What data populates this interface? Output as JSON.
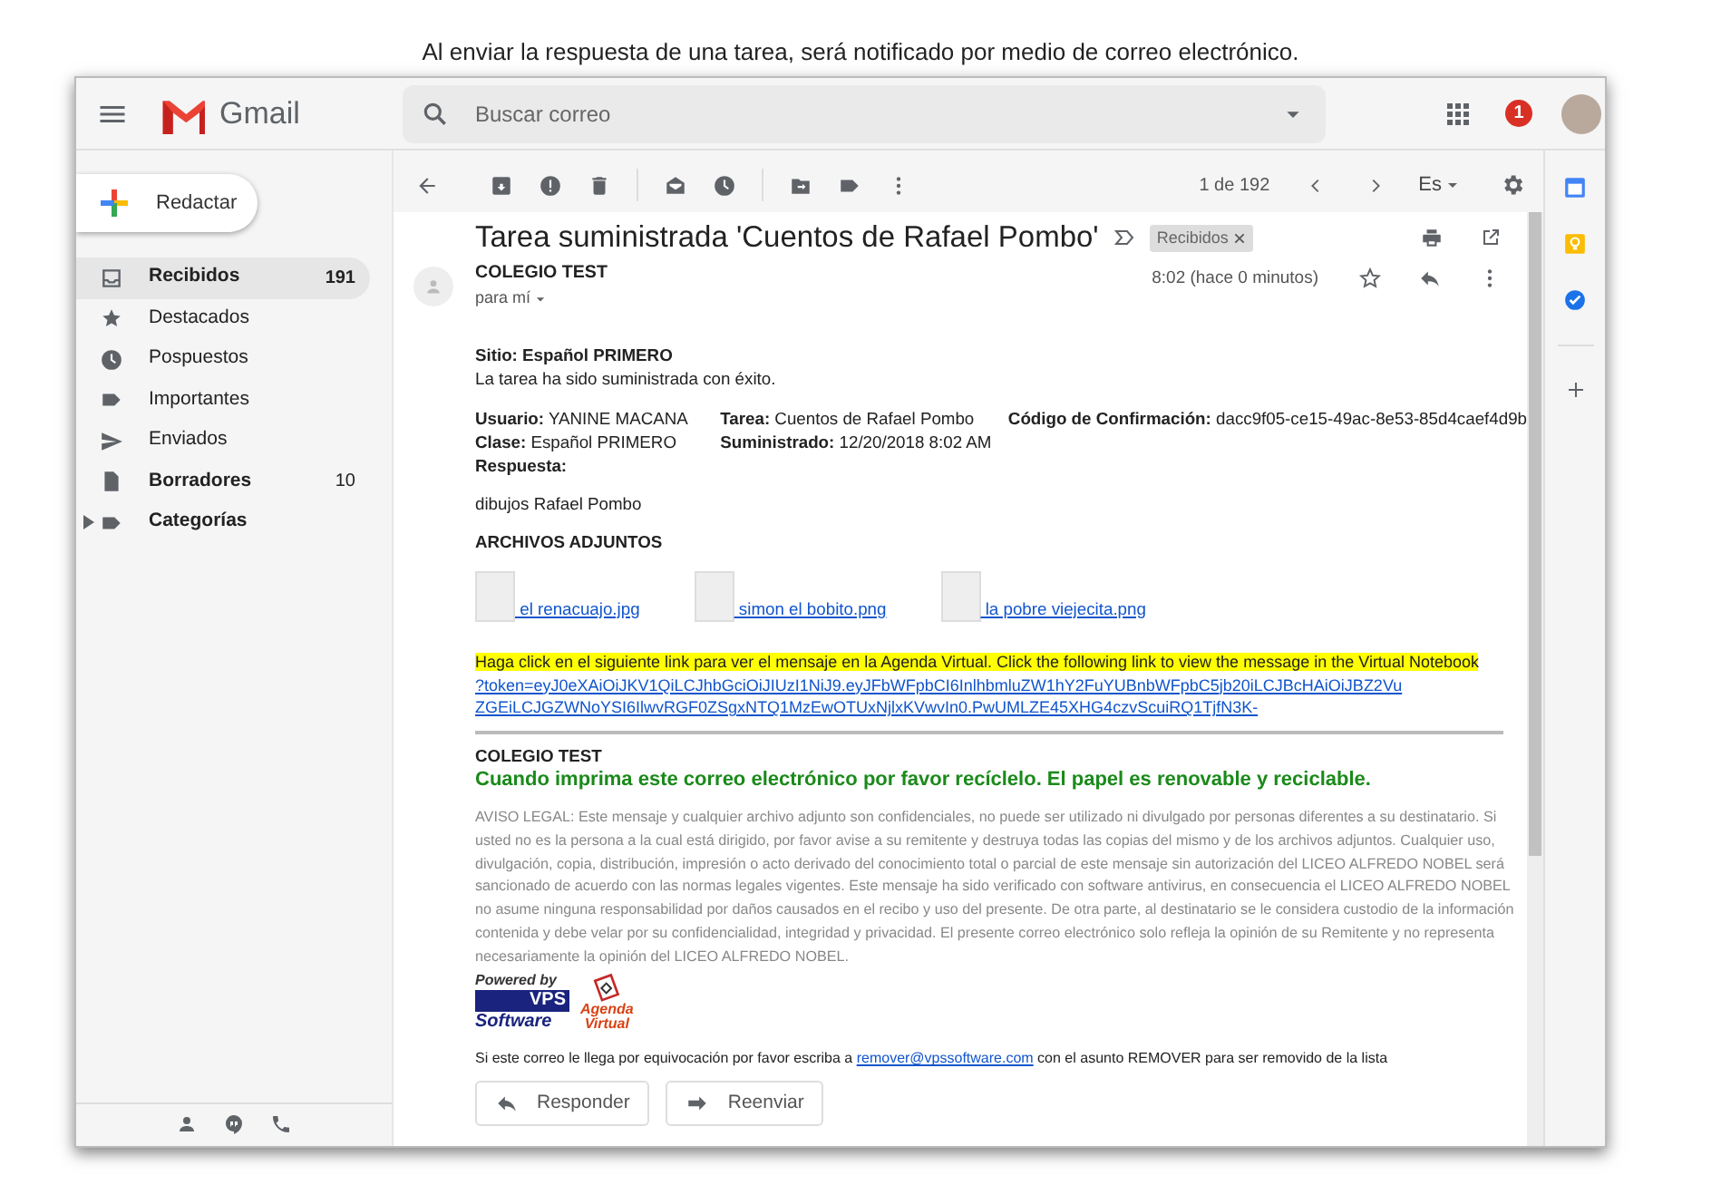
{
  "caption": "Al enviar la respuesta de una tarea, será notificado por medio de correo electrónico.",
  "header": {
    "logo_text": "Gmail",
    "search": {
      "placeholder": "Buscar correo"
    },
    "notifications": "1"
  },
  "sidebar": {
    "compose": "Redactar",
    "items": [
      {
        "label": "Recibidos",
        "count": "191",
        "bold": true,
        "selected": true
      },
      {
        "label": "Destacados",
        "bold": false,
        "selected": false
      },
      {
        "label": "Pospuestos",
        "bold": false,
        "selected": false
      },
      {
        "label": "Importantes",
        "bold": false,
        "selected": false
      },
      {
        "label": "Enviados",
        "bold": false,
        "selected": false
      },
      {
        "label": "Borradores",
        "count": "10",
        "bold": true,
        "selected": false
      },
      {
        "label": "Categorías",
        "bold": true,
        "selected": false,
        "expanded": false
      }
    ]
  },
  "toolbar": {
    "pager": "1 de 192",
    "language": "Es"
  },
  "message": {
    "subject": "Tarea suministrada 'Cuentos de Rafael Pombo'",
    "label_chip": "Recibidos",
    "sender": "COLEGIO TEST",
    "recipient": "para mí",
    "time": "8:02 (hace 0 minutos)",
    "body": {
      "site": "Sitio: Español PRIMERO",
      "status": "La tarea ha sido suministrada con éxito.",
      "fields": [
        [
          "**Usuario:** YANINE MACANA",
          "**Clase:** Español PRIMERO",
          "**Respuesta:**"
        ],
        [
          "**Tarea:** Cuentos de Rafael Pombo",
          "**Suministrado:** 12/20/2018 8:02 AM"
        ],
        [
          "**Código de Confirmación:** dacc9f05-ce15-49ac-8e53-85d4caef4d9b"
        ]
      ],
      "answer": "dibujos Rafael Pombo",
      "attachments_title": "ARCHIVOS ADJUNTOS",
      "attachments": [
        {
          "name": " el renacuajo.jpg"
        },
        {
          "name": " simon el bobito.png"
        },
        {
          "name": " la pobre viejecita.png"
        }
      ],
      "highlight": "Haga click en el siguiente link para ver el mensaje en la Agenda Virtual. Click the following link to view the message in the Virtual Notebook",
      "token_link": [
        "?token=eyJ0eXAiOiJKV1QiLCJhbGciOiJIUzI1NiJ9.eyJFbWFpbCI6InlhbmluZW1hY2FuYUBnbWFpbC5jb20iLCJBcHAiOiJBZ2Vu",
        "ZGEiLCJGZWNoYSI6IlwvRGF0ZSgxNTQ1MzEwOTUxNjlxKVwvIn0.PwUMLZE45XHG4czvScuiRQ1TjfN3K-"
      ],
      "school": "COLEGIO TEST",
      "recycle": "Cuando imprima este correo electrónico por favor recíclelo. El papel es renovable y reciclable.",
      "legal": "AVISO LEGAL: Este mensaje y cualquier archivo adjunto son confidenciales, no puede ser utilizado ni divulgado por personas diferentes a su destinatario. Si usted no es la persona a la cual está dirigido, por favor avise a su remitente y destruya todas las copias del mismo y de los archivos adjuntos. Cualquier uso, divulgación, copia, distribución, impresión o acto derivado del conocimiento total o parcial de este mensaje sin autorización del LICEO ALFREDO NOBEL será sancionado de acuerdo con las normas legales vigentes. Este mensaje ha sido verificado con software antivirus, en consecuencia el LICEO ALFREDO NOBEL no asume ninguna responsabilidad por daños causados en el recibo y uso del presente. De otra parte, al destinatario se le considera custodio de la información contenida y debe velar por su confidencialidad, integridad y privacidad. El presente correo electrónico solo refleja la opinión de su Remitente y no representa necesariamente la opinión del LICEO ALFREDO NOBEL.",
      "powered_by": {
        "label": "Powered by",
        "brand": "VPS",
        "product": "Software"
      },
      "agenda_logo": [
        "Agenda",
        "Virtual"
      ],
      "unsubscribe": {
        "before": "Si este correo le llega por equivocación por favor escriba a",
        "email": "remover@vpssoftware.com",
        "after": "con el asunto REMOVER para ser removido de la lista"
      }
    },
    "actions": [
      "Responder",
      "Reenviar"
    ]
  }
}
